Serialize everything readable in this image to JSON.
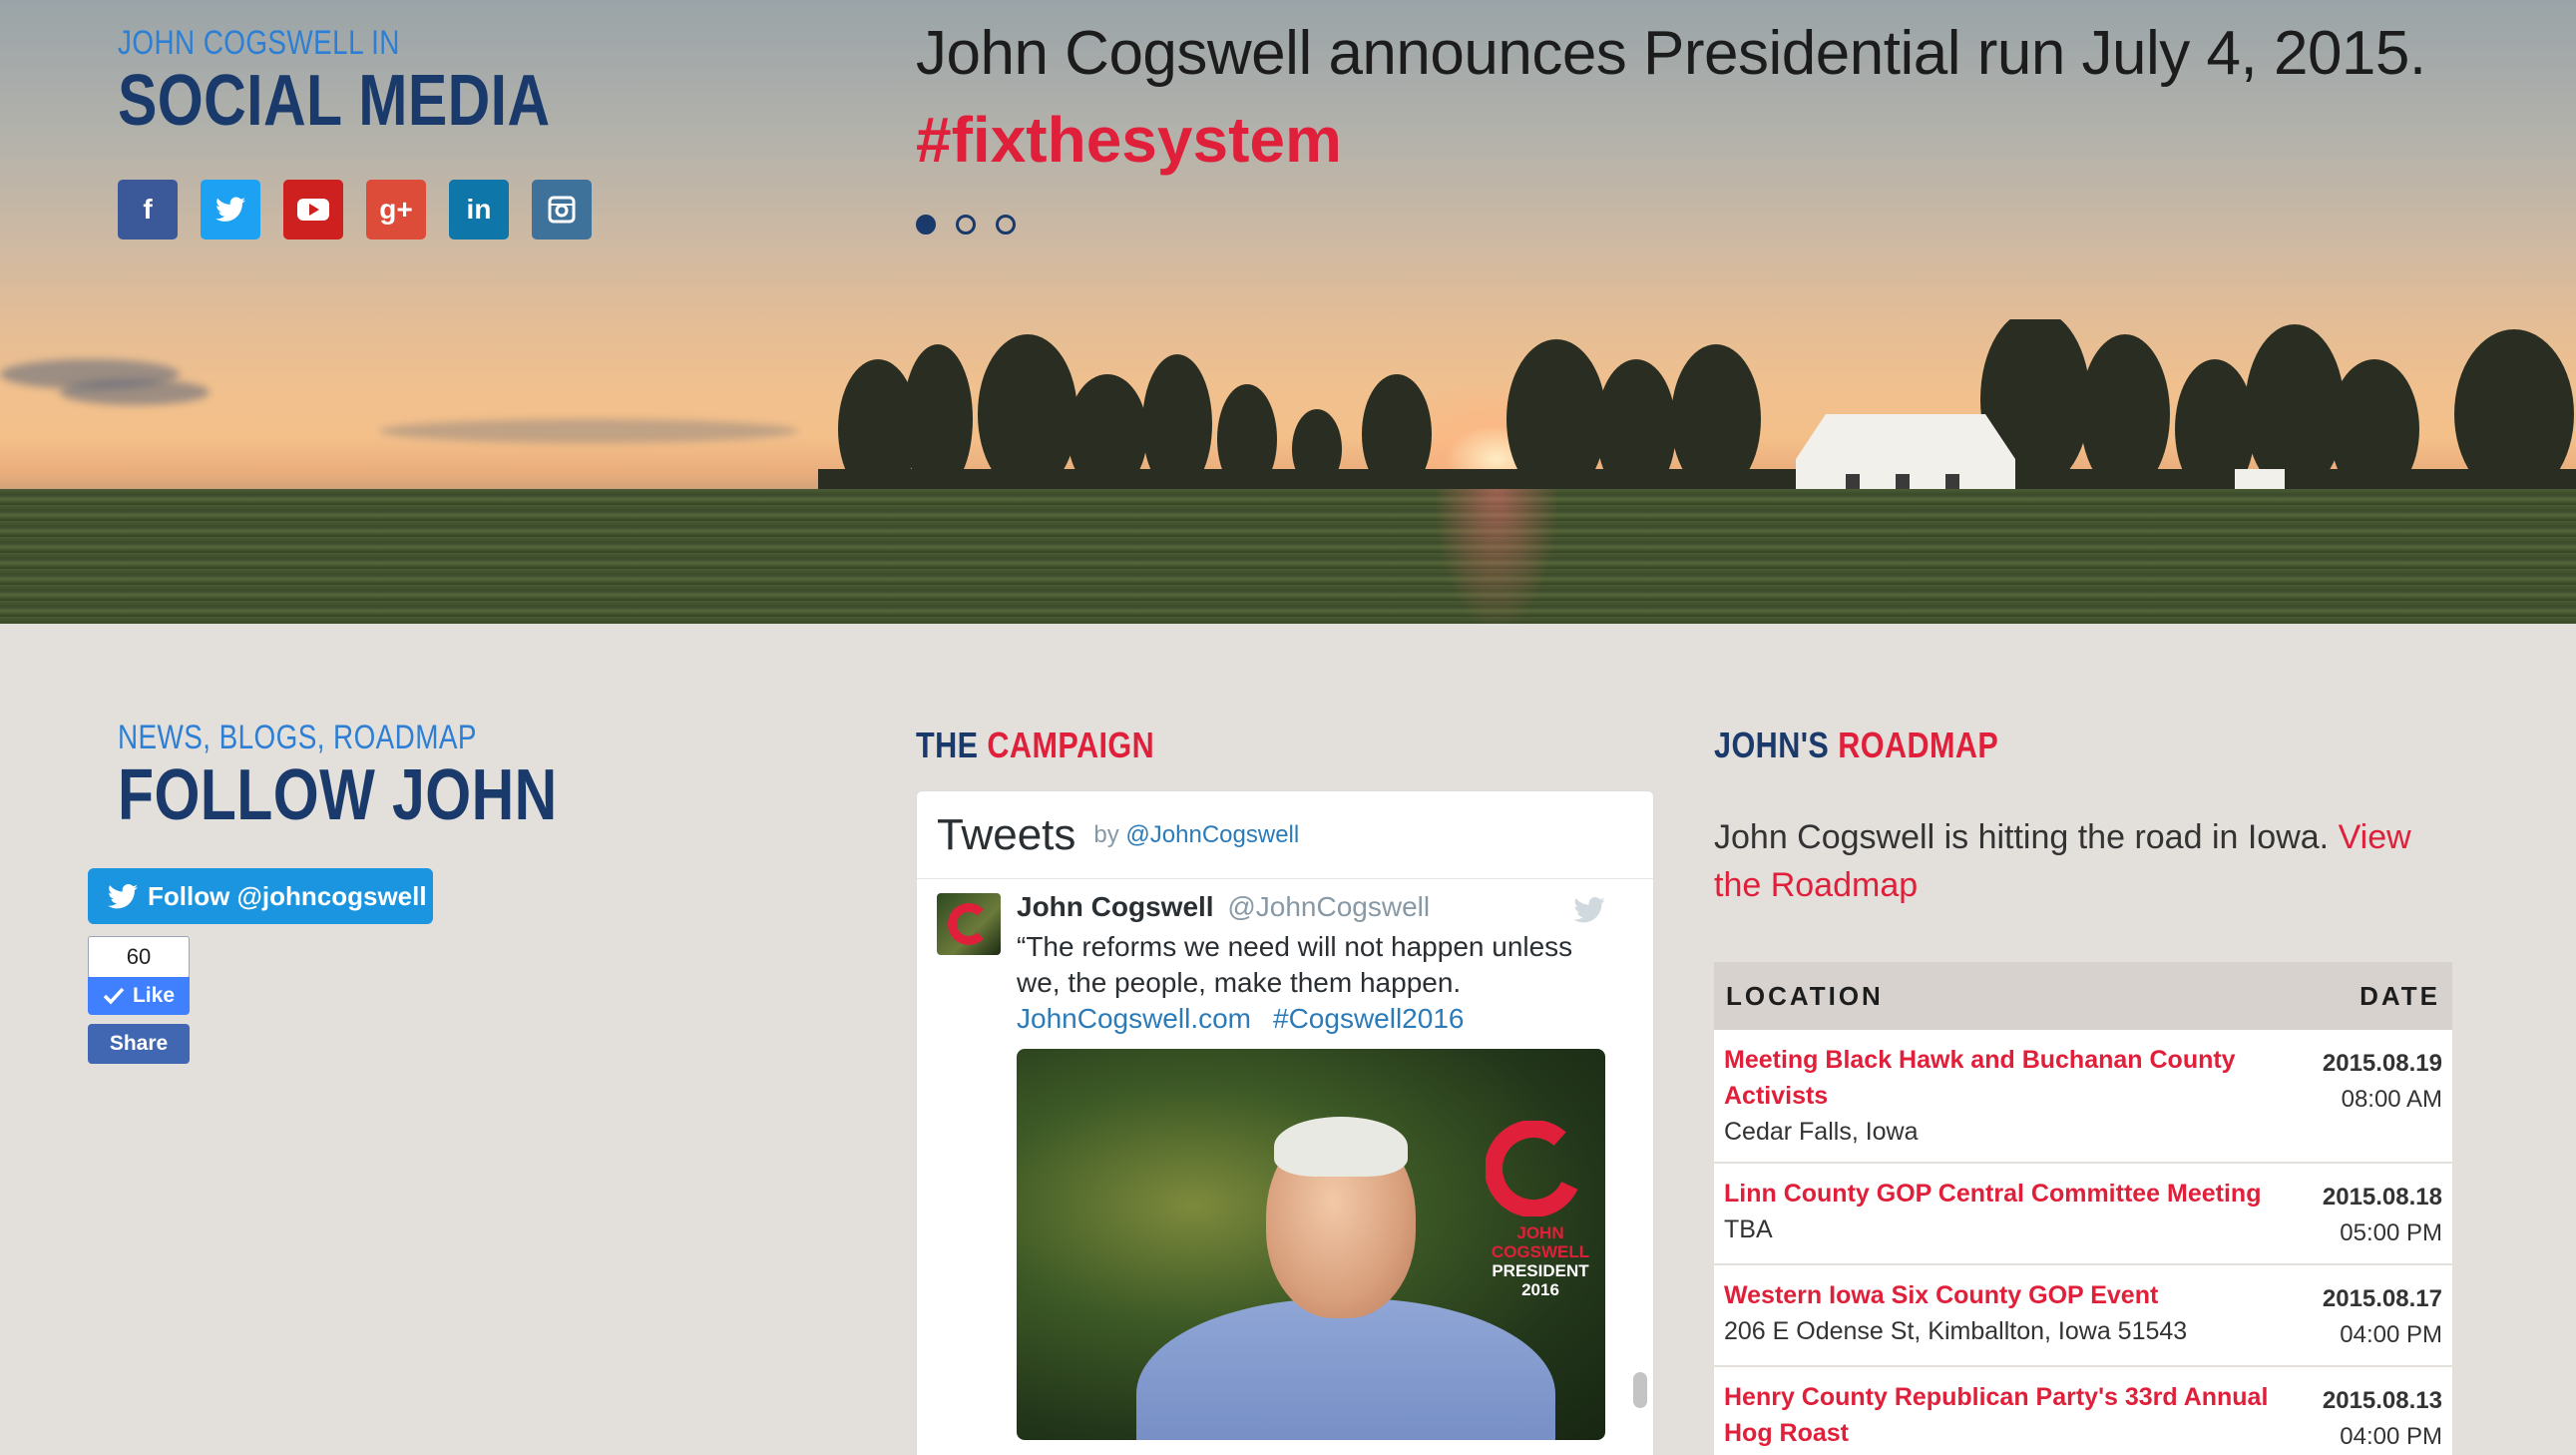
{
  "hero": {
    "social": {
      "eyebrow": "JOHN COGSWELL IN",
      "heading": "SOCIAL MEDIA",
      "icons": [
        {
          "name": "facebook",
          "glyph": "f",
          "color": "#3b5998"
        },
        {
          "name": "twitter",
          "glyph": "t",
          "color": "#1da1f2"
        },
        {
          "name": "youtube",
          "glyph": "▶",
          "color": "#cd201f"
        },
        {
          "name": "google-plus",
          "glyph": "g+",
          "color": "#dd4b39"
        },
        {
          "name": "linkedin",
          "glyph": "in",
          "color": "#0e76a8"
        },
        {
          "name": "instagram",
          "glyph": "◎",
          "color": "#3f729b"
        }
      ]
    },
    "headline": "John Cogswell announces Presidential run July 4, 2015.",
    "hashtag": "#fixthesystem",
    "carousel": {
      "count": 3,
      "active": 0
    }
  },
  "follow": {
    "eyebrow": "NEWS, BLOGS, ROADMAP",
    "heading": "FOLLOW JOHN",
    "twitter_button": "Follow @johncogswell",
    "fb_like_count": "60",
    "fb_like_label": "Like",
    "fb_share_label": "Share"
  },
  "campaign": {
    "title_part1": "THE",
    "title_part2": "CAMPAIGN",
    "timeline": {
      "title": "Tweets",
      "by": "by",
      "by_handle": "@JohnCogswell",
      "tweet": {
        "name": "John Cogswell",
        "handle": "@JohnCogswell",
        "text": "“The reforms we need will not happen unless we, the people, make them happen.",
        "link1": "JohnCogswell.com",
        "link2": "#Cogswell2016",
        "photo_logo_line1": "JOHN COGSWELL",
        "photo_logo_line2": "PRESIDENT 2016"
      }
    }
  },
  "roadmap": {
    "title_part1": "JOHN'S",
    "title_part2": "ROADMAP",
    "intro": "John Cogswell is hitting the road in Iowa.",
    "intro_link": "View the Roadmap",
    "columns": [
      "LOCATION",
      "DATE"
    ],
    "events": [
      {
        "name": "Meeting Black Hawk and Buchanan County Activists",
        "location": "Cedar Falls, Iowa",
        "date": "2015.08.19",
        "time": "08:00 AM"
      },
      {
        "name": "Linn County GOP Central Committee Meeting",
        "location": "TBA",
        "date": "2015.08.18",
        "time": "05:00 PM"
      },
      {
        "name": "Western Iowa Six County GOP Event",
        "location": "206 E Odense St, Kimballton, Iowa 51543",
        "date": "2015.08.17",
        "time": "04:00 PM"
      },
      {
        "name": "Henry County Republican Party's 33rd Annual Hog Roast",
        "location": "",
        "date": "2015.08.13",
        "time": "04:00 PM"
      }
    ]
  },
  "colors": {
    "navy": "#1a3a6b",
    "accent_red": "#e0203a",
    "link_blue": "#2c7fd4",
    "page_bg": "#e3dfdb"
  }
}
